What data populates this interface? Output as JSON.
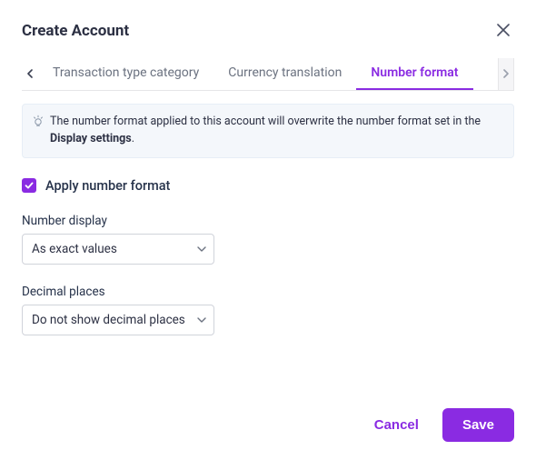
{
  "header": {
    "title": "Create Account"
  },
  "tabs": {
    "items": [
      {
        "label": "Transaction type category",
        "active": false
      },
      {
        "label": "Currency translation",
        "active": false
      },
      {
        "label": "Number format",
        "active": true
      }
    ]
  },
  "info": {
    "pre": "The number format applied to this account will overwrite the number format set in the ",
    "bold": "Display settings",
    "post": "."
  },
  "apply": {
    "label": "Apply number format",
    "checked": true
  },
  "number_display": {
    "label": "Number display",
    "value": "As exact values"
  },
  "decimal_places": {
    "label": "Decimal places",
    "value": "Do not show decimal places"
  },
  "footer": {
    "cancel": "Cancel",
    "save": "Save"
  }
}
